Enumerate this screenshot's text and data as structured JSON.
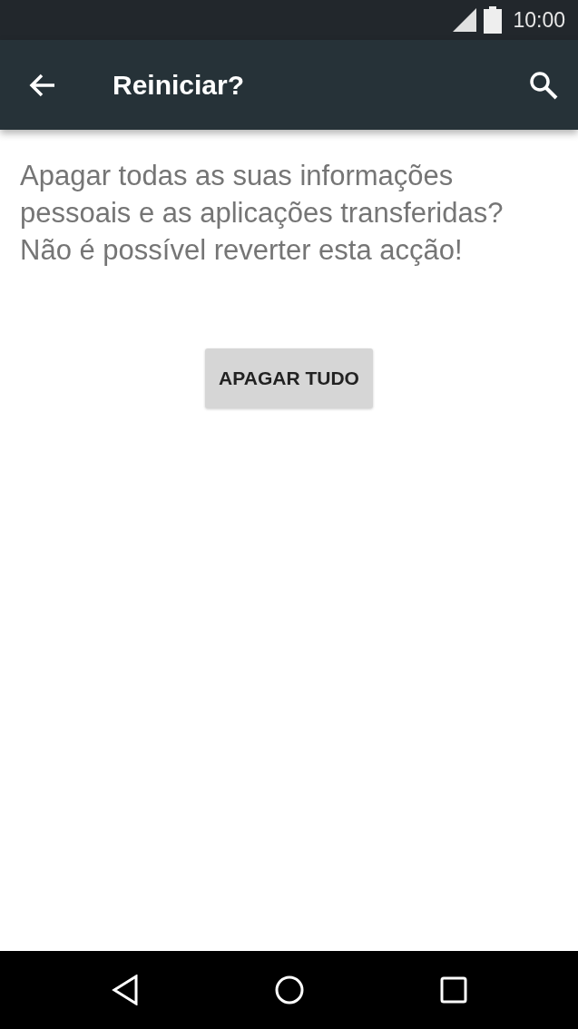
{
  "status_bar": {
    "time": "10:00"
  },
  "app_bar": {
    "title": "Reiniciar?"
  },
  "message": "Apagar todas as suas informações pessoais e as aplicações transferidas? Não é possível reverter esta acção!",
  "button": {
    "label": "APAGAR TUDO"
  }
}
